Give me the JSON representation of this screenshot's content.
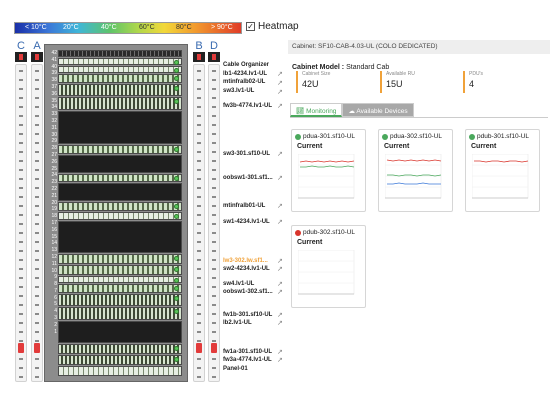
{
  "heatmap": {
    "scale_labels": [
      "< 10°C",
      "20°C",
      "40°C",
      "60°C",
      "80°C",
      "> 90°C"
    ],
    "toggle_label": "Heatmap",
    "checked": true
  },
  "pdus": {
    "left": [
      "C",
      "A"
    ],
    "right": [
      "B",
      "D"
    ]
  },
  "rack": {
    "unit_numbers": [
      "42",
      "41",
      "40",
      "39",
      "38",
      "37",
      "36",
      "35",
      "34",
      "33",
      "32",
      "31",
      "30",
      "29",
      "28",
      "27",
      "26",
      "25",
      "24",
      "23",
      "22",
      "21",
      "20",
      "19",
      "18",
      "17",
      "16",
      "15",
      "14",
      "13",
      "12",
      "11",
      "10",
      "9",
      "8",
      "7",
      "6",
      "5",
      "4",
      "3",
      "2",
      "1"
    ],
    "labels": [
      {
        "text": "Cable Organizer",
        "orange": false
      },
      {
        "text": "lb1-4234.lv1-UL",
        "orange": false
      },
      {
        "text": "mtinfralb02-UL",
        "orange": false
      },
      {
        "text": "sw3.lv1-UL",
        "orange": false
      },
      {
        "text": "fw3b-4774.lv1-UL",
        "orange": false
      },
      {
        "text": "sw3-301.sf10-UL",
        "orange": false
      },
      {
        "text": "oobsw1-301.sf1...",
        "orange": false
      },
      {
        "text": "mtinfralb01-UL",
        "orange": false
      },
      {
        "text": "sw1-4234.lv1-UL",
        "orange": false
      },
      {
        "text": "lw3-302.lw.sf1...",
        "orange": true
      },
      {
        "text": "sw2-4234.lv1-UL",
        "orange": false
      },
      {
        "text": "sw4.lv1-UL",
        "orange": false
      },
      {
        "text": "oobsw1-302.sf1...",
        "orange": false
      },
      {
        "text": "fw1b-301.sf10-UL",
        "orange": false
      },
      {
        "text": "lb2.lv1-UL",
        "orange": false
      },
      {
        "text": "fw1a-301.sf10-UL",
        "orange": false
      },
      {
        "text": "fw3a-4774.lv1-UL",
        "orange": false
      },
      {
        "text": "Panel-01",
        "orange": false
      }
    ]
  },
  "cabinet": {
    "title": "Cabinet: SF10-CAB-4.03-UL (COLO DEDICATED)",
    "model_label": "Cabinet Model :",
    "model_value": "Standard Cab",
    "stats": [
      {
        "label": "Cabinet Size",
        "value": "42U"
      },
      {
        "label": "Available RU",
        "value": "15U"
      },
      {
        "label": "PDU's",
        "value": "4"
      }
    ]
  },
  "tabs": [
    {
      "label": "Monitoring",
      "active": true,
      "icon": "chart-icon"
    },
    {
      "label": "Available Devices",
      "active": false,
      "icon": "cloud-icon"
    }
  ],
  "cards": [
    {
      "name": "pdua-301.sf10-UL",
      "status": "ok",
      "metric": "Current"
    },
    {
      "name": "pdua-302.sf10-UL",
      "status": "ok",
      "metric": "Current"
    },
    {
      "name": "pdub-301.sf10-UL",
      "status": "ok",
      "metric": "Current"
    },
    {
      "name": "pdub-302.sf10-UL",
      "status": "error",
      "metric": "Current"
    }
  ],
  "colors": {
    "ok": "#4aa85c",
    "error": "#d9342b",
    "accent": "#f0a23a"
  }
}
